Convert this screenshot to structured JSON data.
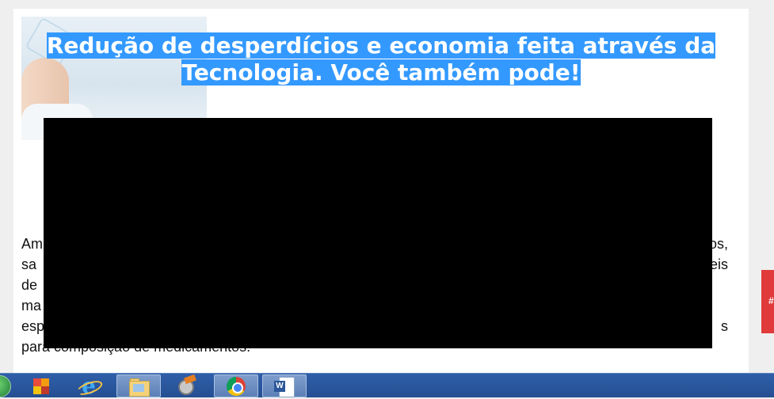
{
  "article": {
    "headline": "Redução de desperdícios e economia feita através da Tecnologia. Você também pode!",
    "body_lines": [
      "Am",
      "os,",
      "sa",
      "eis",
      "de",
      "ma",
      "esp",
      "s",
      "para composição de medicamentos."
    ]
  },
  "side_tab": {
    "label": "#",
    "color": "#e03a3a"
  },
  "colors": {
    "selection": "#3399ff",
    "taskbar": "#2f5ea8",
    "redaction": "#000000"
  },
  "taskbar": {
    "items": [
      {
        "icon": "start-orb-icon"
      },
      {
        "icon": "media-player-icon"
      },
      {
        "icon": "internet-explorer-icon"
      },
      {
        "icon": "file-explorer-icon"
      },
      {
        "icon": "movie-maker-icon"
      },
      {
        "icon": "chrome-icon"
      },
      {
        "icon": "word-icon",
        "glyph": "W"
      }
    ]
  }
}
